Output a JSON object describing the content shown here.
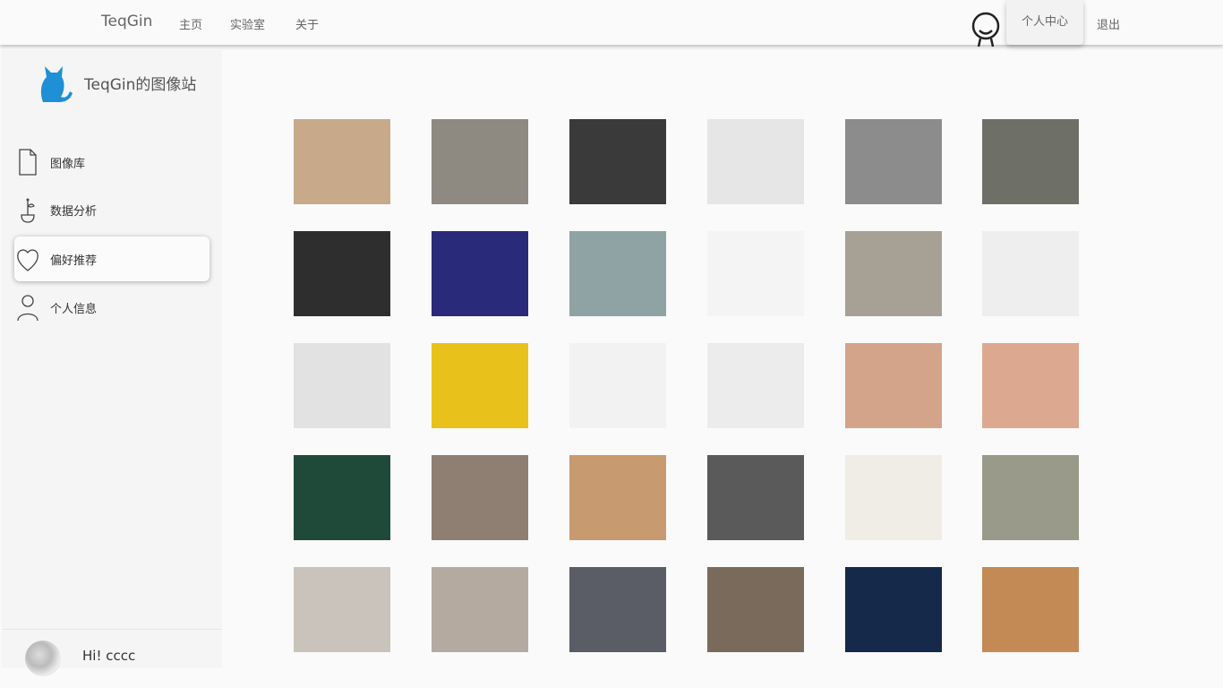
{
  "topbar": {
    "brand": "TeqGin",
    "nav": [
      "主页",
      "实验室",
      "关于"
    ],
    "avatar_icon": "smiley-user-icon",
    "user_center": "个人中心",
    "logout": "退出"
  },
  "sidebar": {
    "logo_icon": "cat-logo-icon",
    "site_name": "TeqGin的图像站",
    "items": [
      {
        "label": "图像库",
        "icon": "file-icon",
        "active": false
      },
      {
        "label": "数据分析",
        "icon": "plant-icon",
        "active": false
      },
      {
        "label": "偏好推荐",
        "icon": "heart-icon",
        "active": true
      },
      {
        "label": "个人信息",
        "icon": "person-icon",
        "active": false
      }
    ],
    "footer": {
      "greeting": "Hi! cccc"
    }
  },
  "gallery": {
    "images": [
      {
        "name": "paper-cups-on-shelf",
        "bg": "#c8a98a"
      },
      {
        "name": "kraft-paper-cup",
        "bg": "#8e8a82"
      },
      {
        "name": "printed-cups-mockup-dark",
        "bg": "#3a3a3a"
      },
      {
        "name": "white-cups-lying",
        "bg": "#e6e6e6"
      },
      {
        "name": "stacked-white-cups-gray",
        "bg": "#8c8c8c"
      },
      {
        "name": "kraft-cup-gray-bg",
        "bg": "#6e7068"
      },
      {
        "name": "cup-template-dark",
        "bg": "#2e2e2e"
      },
      {
        "name": "cup-template-blue",
        "bg": "#2a2a7a"
      },
      {
        "name": "white-cups-teal",
        "bg": "#8fa3a5"
      },
      {
        "name": "colorful-cups-row",
        "bg": "#f4f4f4"
      },
      {
        "name": "pink-paper-cups",
        "bg": "#a7a095"
      },
      {
        "name": "red-pattern-cups",
        "bg": "#eeeeee"
      },
      {
        "name": "white-cup-logo",
        "bg": "#e2e2e2"
      },
      {
        "name": "black-lid-cup-yellow",
        "bg": "#e8c21a"
      },
      {
        "name": "printed-cup-closeup",
        "bg": "#f2f2f2"
      },
      {
        "name": "cup-with-straw",
        "bg": "#ececec"
      },
      {
        "name": "gray-cat-peach",
        "bg": "#d4a48a"
      },
      {
        "name": "gray-cat-standing",
        "bg": "#dca88f"
      },
      {
        "name": "tabby-cat-green",
        "bg": "#1f4a3a"
      },
      {
        "name": "orange-white-cat",
        "bg": "#8e7f72"
      },
      {
        "name": "orange-cat-closeup",
        "bg": "#c89a70"
      },
      {
        "name": "gray-cat-lying",
        "bg": "#5a5a5a"
      },
      {
        "name": "cream-cat-sitting",
        "bg": "#f0ece6"
      },
      {
        "name": "white-gray-cat",
        "bg": "#9a9a8a"
      },
      {
        "name": "orange-cat-lying",
        "bg": "#c9c3bc"
      },
      {
        "name": "orange-cat-peek",
        "bg": "#b4aaa0"
      },
      {
        "name": "gray-cat-fluffy",
        "bg": "#5a5c66"
      },
      {
        "name": "gray-cat-window",
        "bg": "#7a6a5c"
      },
      {
        "name": "silver-tabby-blue",
        "bg": "#15294a"
      },
      {
        "name": "cat-with-juice-box",
        "bg": "#c48a55"
      }
    ]
  }
}
